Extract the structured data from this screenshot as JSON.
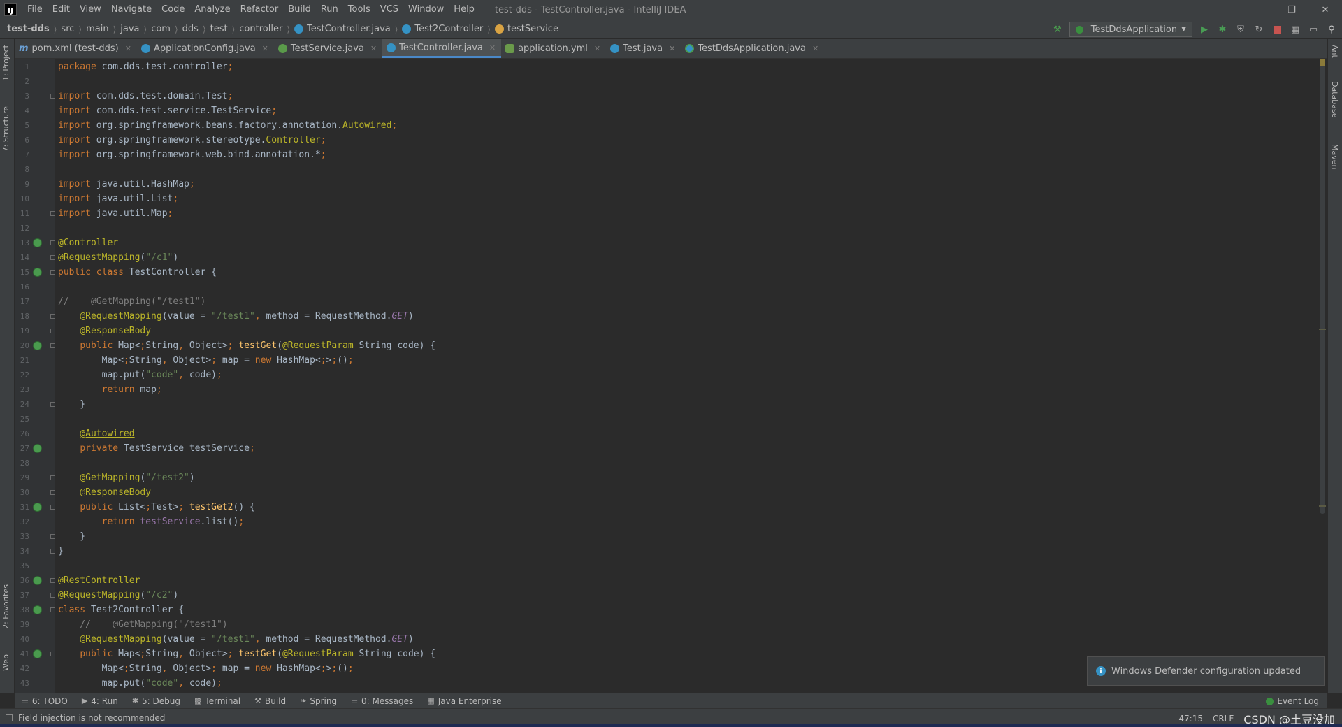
{
  "app": {
    "logo": "IJ",
    "title": "test-dds - TestController.java - IntelliJ IDEA"
  },
  "menu": [
    "File",
    "Edit",
    "View",
    "Navigate",
    "Code",
    "Analyze",
    "Refactor",
    "Build",
    "Run",
    "Tools",
    "VCS",
    "Window",
    "Help"
  ],
  "breadcrumb": [
    "test-dds",
    "src",
    "main",
    "java",
    "com",
    "dds",
    "test",
    "controller",
    "TestController.java",
    "Test2Controller",
    "testService"
  ],
  "run_config": "TestDdsApplication",
  "left_stripe": [
    "1: Project",
    "7: Structure",
    "2: Favorites",
    "Web"
  ],
  "right_stripe": [
    "Ant",
    "Database",
    "Maven"
  ],
  "tabs": [
    {
      "label": "pom.xml (test-dds)",
      "icon": "maven-icon"
    },
    {
      "label": "ApplicationConfig.java",
      "icon": "class-icon"
    },
    {
      "label": "TestService.java",
      "icon": "interface-icon"
    },
    {
      "label": "TestController.java",
      "icon": "class-icon",
      "active": true
    },
    {
      "label": "application.yml",
      "icon": "yaml-icon"
    },
    {
      "label": "Test.java",
      "icon": "class-icon"
    },
    {
      "label": "TestDdsApplication.java",
      "icon": "spring-boot-icon"
    }
  ],
  "code_lines": [
    "package com.dds.test.controller;",
    "",
    "import com.dds.test.domain.Test;",
    "import com.dds.test.service.TestService;",
    "import org.springframework.beans.factory.annotation.Autowired;",
    "import org.springframework.stereotype.Controller;",
    "import org.springframework.web.bind.annotation.*;",
    "",
    "import java.util.HashMap;",
    "import java.util.List;",
    "import java.util.Map;",
    "",
    "@Controller",
    "@RequestMapping(\"/c1\")",
    "public class TestController {",
    "",
    "//    @GetMapping(\"/test1\")",
    "    @RequestMapping(value = \"/test1\", method = RequestMethod.GET)",
    "    @ResponseBody",
    "    public Map<String, Object> testGet(@RequestParam String code) {",
    "        Map<String, Object> map = new HashMap<>();",
    "        map.put(\"code\", code);",
    "        return map;",
    "    }",
    "",
    "    @Autowired",
    "    private TestService testService;",
    "",
    "    @GetMapping(\"/test2\")",
    "    @ResponseBody",
    "    public List<Test> testGet2() {",
    "        return testService.list();",
    "    }",
    "}",
    "",
    "@RestController",
    "@RequestMapping(\"/c2\")",
    "class Test2Controller {",
    "    //    @GetMapping(\"/test1\")",
    "    @RequestMapping(value = \"/test1\", method = RequestMethod.GET)",
    "    public Map<String, Object> testGet(@RequestParam String code) {",
    "        Map<String, Object> map = new HashMap<>();",
    "        map.put(\"code\", code);"
  ],
  "line_numbers": [
    "1",
    "2",
    "3",
    "4",
    "5",
    "6",
    "7",
    "8",
    "9",
    "10",
    "11",
    "12",
    "13",
    "14",
    "15",
    "16",
    "17",
    "18",
    "19",
    "20",
    "21",
    "22",
    "23",
    "24",
    "25",
    "26",
    "27",
    "28",
    "29",
    "30",
    "31",
    "32",
    "33",
    "34",
    "35",
    "36",
    "37",
    "38",
    "39",
    "40",
    "41",
    "42",
    "43"
  ],
  "notification": "Windows Defender configuration updated",
  "tool_windows": [
    {
      "label": "6: TODO",
      "icon": "todo-icon"
    },
    {
      "label": "4: Run",
      "icon": "run-icon"
    },
    {
      "label": "5: Debug",
      "icon": "debug-icon"
    },
    {
      "label": "Terminal",
      "icon": "terminal-icon"
    },
    {
      "label": "Build",
      "icon": "build-icon"
    },
    {
      "label": "Spring",
      "icon": "spring-icon"
    },
    {
      "label": "0: Messages",
      "icon": "messages-icon"
    },
    {
      "label": "Java Enterprise",
      "icon": "java-enterprise-icon"
    }
  ],
  "event_log": "Event Log",
  "status": {
    "message": "Field injection is not recommended",
    "position": "47:15",
    "line_ending": "CRLF",
    "watermark": "CSDN @土豆没加"
  },
  "colors": {
    "background": "#2b2b2b",
    "keyword": "#cc7832",
    "annotation": "#bbb529",
    "string": "#6a8759",
    "comment": "#808080",
    "method": "#ffc66d",
    "field": "#9876aa",
    "active_tab_accent": "#4a88c7"
  }
}
